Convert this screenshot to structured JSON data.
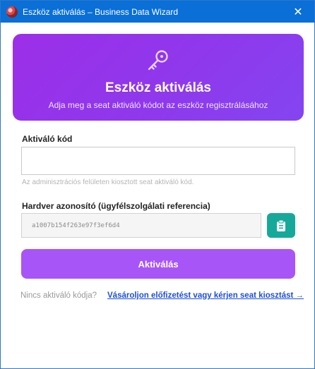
{
  "window": {
    "title": "Eszköz aktiválás – Business Data Wizard",
    "close_glyph": "✕"
  },
  "hero": {
    "icon": "key-icon",
    "title": "Eszköz aktiválás",
    "subtitle": "Adja meg a seat aktiváló kódot az eszköz regisztrálásához"
  },
  "activation": {
    "label": "Aktiváló kód",
    "value": "",
    "placeholder": "",
    "helper": "Az adminisztrációs felületen kiosztott seat aktiváló kód."
  },
  "hardware": {
    "label": "Hardver azonosító (ügyfélszolgálati referencia)",
    "value": "a1007b154f263e97f3ef6d4",
    "copy_icon": "clipboard-icon"
  },
  "actions": {
    "activate_label": "Aktiválás"
  },
  "footer": {
    "question": "Nincs aktiváló kódja?",
    "link": "Vásároljon előfizetést vagy kérjen seat kiosztást →"
  },
  "colors": {
    "titlebar": "#0a6fd6",
    "hero_gradient_start": "#9c2fe8",
    "hero_gradient_end": "#8445f0",
    "activate_button": "#a855f7",
    "copy_button": "#16a99a",
    "link": "#1d4ed8"
  }
}
